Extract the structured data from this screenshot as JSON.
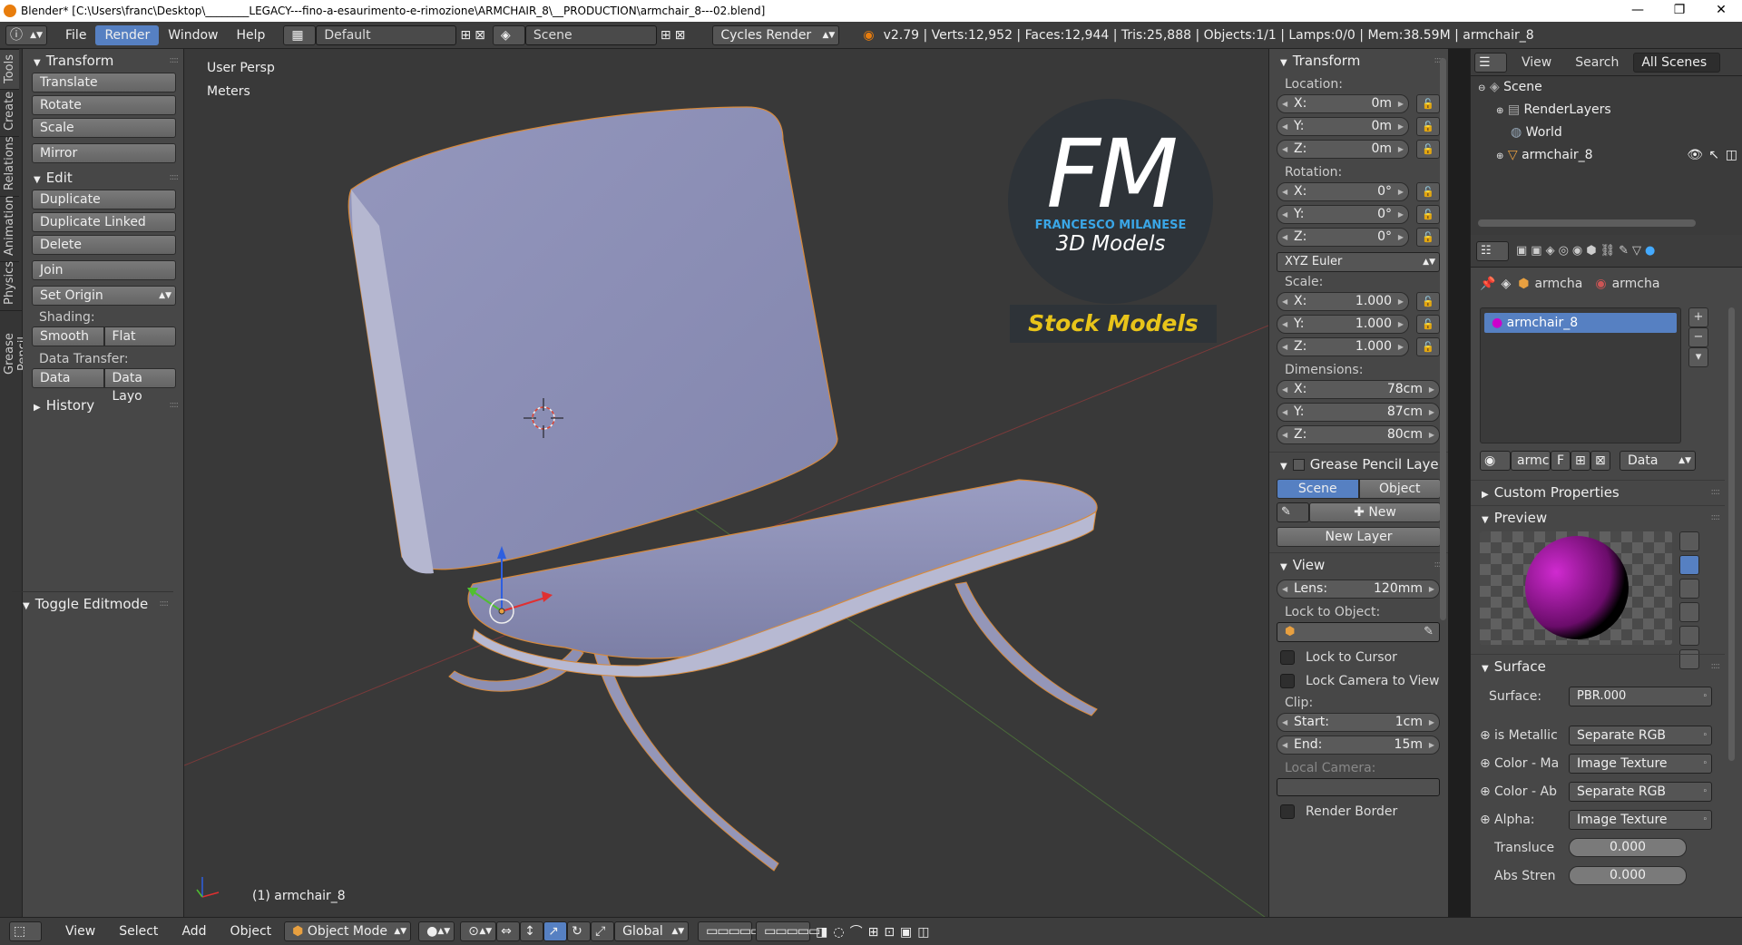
{
  "titlebar": {
    "title": "Blender* [C:\\Users\\franc\\Desktop\\________LEGACY---fino-a-esaurimento-e-rimozione\\ARMCHAIR_8\\__PRODUCTION\\armchair_8---02.blend]"
  },
  "menu": {
    "items": [
      "File",
      "Render",
      "Window",
      "Help"
    ],
    "layout": "Default",
    "scene": "Scene",
    "engine": "Cycles Render",
    "info": "v2.79 | Verts:12,952 | Faces:12,944 | Tris:25,888 | Objects:1/1 | Lamps:0/0 | Mem:38.59M | armchair_8"
  },
  "tabs": [
    "Tools",
    "Create",
    "Relations",
    "Animation",
    "Physics",
    "Grease Pencil"
  ],
  "toolpanel": {
    "transform_title": "Transform",
    "translate": "Translate",
    "rotate": "Rotate",
    "scale": "Scale",
    "mirror": "Mirror",
    "edit_title": "Edit",
    "duplicate": "Duplicate",
    "duplicate_linked": "Duplicate Linked",
    "delete": "Delete",
    "join": "Join",
    "set_origin": "Set Origin",
    "shading_label": "Shading:",
    "smooth": "Smooth",
    "flat": "Flat",
    "data_transfer_label": "Data Transfer:",
    "data": "Data",
    "data_layout": "Data Layo",
    "history": "History",
    "toggle_editmode": "Toggle Editmode"
  },
  "viewport": {
    "view_name": "User Persp",
    "units": "Meters",
    "object_label": "(1) armchair_8",
    "logo": {
      "big": "FM",
      "name": "FRANCESCO MILANESE",
      "sub": "3D Models",
      "tag": "Stock Models"
    }
  },
  "npanel": {
    "transform_title": "Transform",
    "location_label": "Location:",
    "location": [
      {
        "k": "X:",
        "v": "0m"
      },
      {
        "k": "Y:",
        "v": "0m"
      },
      {
        "k": "Z:",
        "v": "0m"
      }
    ],
    "rotation_label": "Rotation:",
    "rotation": [
      {
        "k": "X:",
        "v": "0°"
      },
      {
        "k": "Y:",
        "v": "0°"
      },
      {
        "k": "Z:",
        "v": "0°"
      }
    ],
    "rotation_mode": "XYZ Euler",
    "scale_label": "Scale:",
    "scale": [
      {
        "k": "X:",
        "v": "1.000"
      },
      {
        "k": "Y:",
        "v": "1.000"
      },
      {
        "k": "Z:",
        "v": "1.000"
      }
    ],
    "dimensions_label": "Dimensions:",
    "dimensions": [
      {
        "k": "X:",
        "v": "78cm"
      },
      {
        "k": "Y:",
        "v": "87cm"
      },
      {
        "k": "Z:",
        "v": "80cm"
      }
    ],
    "gp_title": "Grease Pencil Layer",
    "gp_scene": "Scene",
    "gp_object": "Object",
    "gp_new": "New",
    "gp_new_layer": "New Layer",
    "view_title": "View",
    "lens_k": "Lens:",
    "lens_v": "120mm",
    "lock_to_object": "Lock to Object:",
    "lock_to_cursor": "Lock to Cursor",
    "lock_camera": "Lock Camera to View",
    "clip_label": "Clip:",
    "clip_start_k": "Start:",
    "clip_start_v": "1cm",
    "clip_end_k": "End:",
    "clip_end_v": "15m",
    "local_camera": "Local Camera:",
    "render_border": "Render Border"
  },
  "outliner": {
    "view": "View",
    "search": "Search",
    "filter": "All Scenes",
    "rows": [
      "Scene",
      "RenderLayers",
      "World",
      "armchair_8"
    ]
  },
  "properties": {
    "breadcrumb1": "armcha",
    "breadcrumb2": "armcha",
    "material": "armchair_8",
    "mat_field": "armc",
    "mat_f": "F",
    "mat_data": "Data",
    "custom_props": "Custom Properties",
    "preview": "Preview",
    "surface_title": "Surface",
    "surface_label": "Surface:",
    "surface_value": "PBR.000",
    "inputs": [
      {
        "k": "is Metallic",
        "v": "Separate RGB"
      },
      {
        "k": "Color - Ma",
        "v": "Image Texture"
      },
      {
        "k": "Color - Ab",
        "v": "Separate RGB"
      },
      {
        "k": "Alpha:",
        "v": "Image Texture"
      }
    ],
    "translucence_k": "Transluce",
    "translucence_v": "0.000",
    "absstr_k": "Abs Stren",
    "absstr_v": "0.000"
  },
  "bottombar": {
    "view": "View",
    "select": "Select",
    "add": "Add",
    "object": "Object",
    "mode": "Object Mode",
    "orientation": "Global"
  }
}
